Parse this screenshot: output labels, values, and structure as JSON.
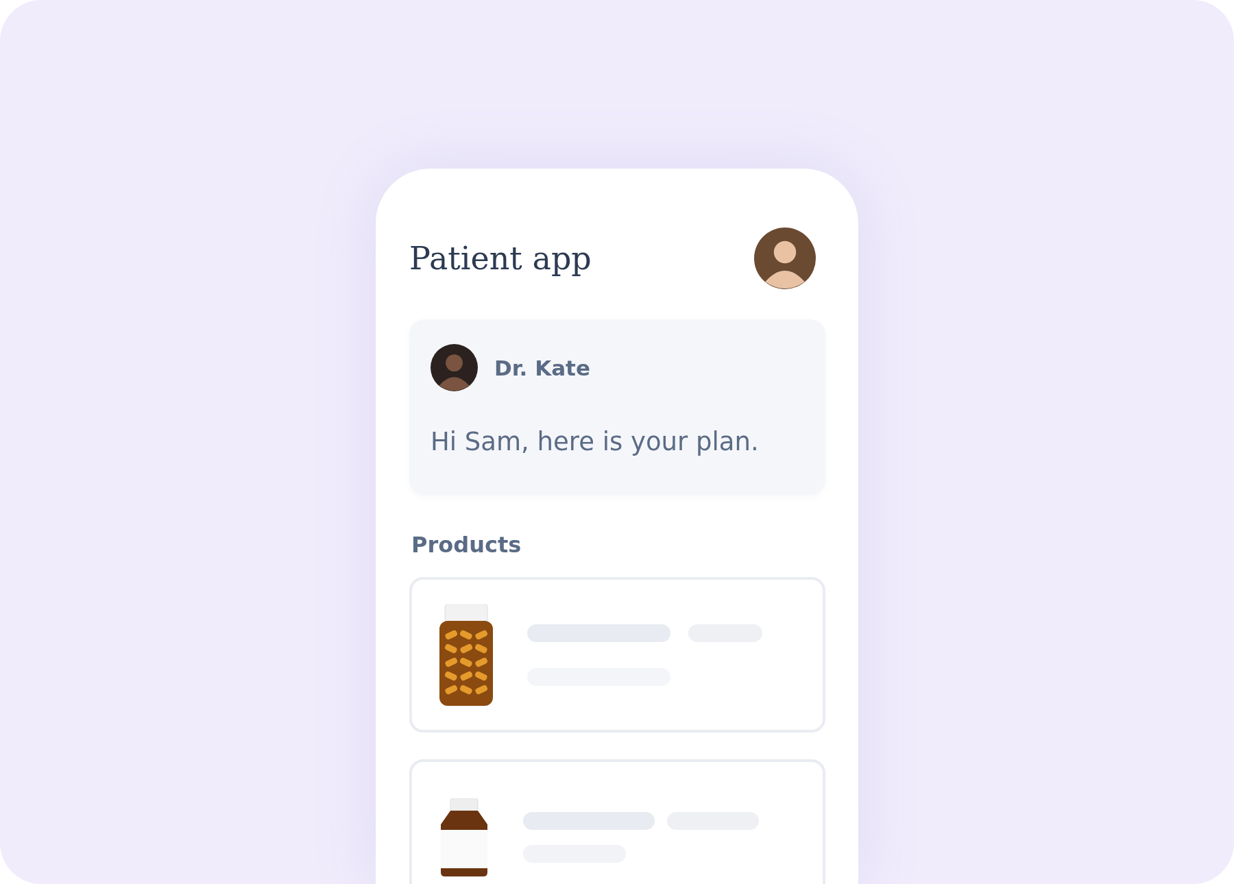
{
  "app": {
    "title": "Patient app"
  },
  "message": {
    "sender": "Dr. Kate",
    "text": "Hi Sam, here is your plan."
  },
  "products": {
    "heading": "Products",
    "items": [
      {
        "kind": "capsule_bottle"
      },
      {
        "kind": "labeled_bottle"
      }
    ]
  }
}
